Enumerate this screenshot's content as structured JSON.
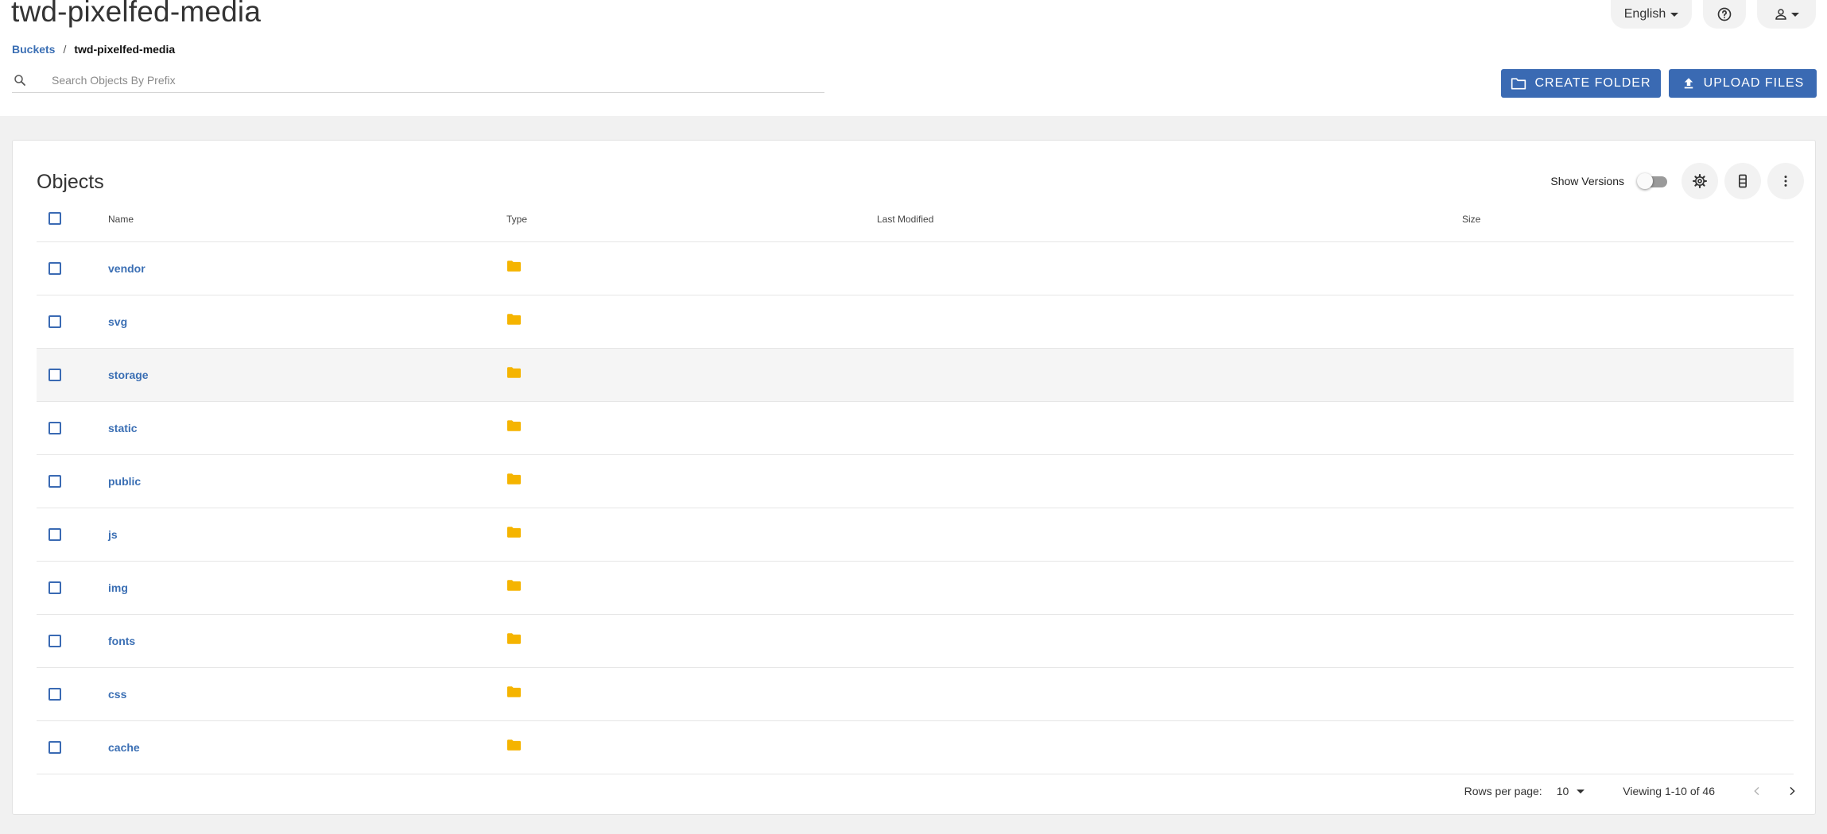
{
  "header": {
    "title": "twd-pixelfed-media",
    "language": "English",
    "breadcrumb": {
      "root": "Buckets",
      "separator": "/",
      "current": "twd-pixelfed-media"
    },
    "search_placeholder": "Search Objects By Prefix",
    "create_folder_label": "CREATE FOLDER",
    "upload_files_label": "UPLOAD FILES"
  },
  "objects": {
    "title": "Objects",
    "show_versions_label": "Show Versions",
    "show_versions_on": false,
    "columns": {
      "name": "Name",
      "type": "Type",
      "last_modified": "Last Modified",
      "size": "Size"
    },
    "rows": [
      {
        "name": "vendor",
        "type": "folder-icon",
        "last_modified": "",
        "size": ""
      },
      {
        "name": "svg",
        "type": "folder-icon",
        "last_modified": "",
        "size": ""
      },
      {
        "name": "storage",
        "type": "folder-icon",
        "last_modified": "",
        "size": ""
      },
      {
        "name": "static",
        "type": "folder-icon",
        "last_modified": "",
        "size": ""
      },
      {
        "name": "public",
        "type": "folder-icon",
        "last_modified": "",
        "size": ""
      },
      {
        "name": "js",
        "type": "folder-icon",
        "last_modified": "",
        "size": ""
      },
      {
        "name": "img",
        "type": "folder-icon",
        "last_modified": "",
        "size": ""
      },
      {
        "name": "fonts",
        "type": "folder-icon",
        "last_modified": "",
        "size": ""
      },
      {
        "name": "css",
        "type": "folder-icon",
        "last_modified": "",
        "size": ""
      },
      {
        "name": "cache",
        "type": "folder-icon",
        "last_modified": "",
        "size": ""
      }
    ]
  },
  "pagination": {
    "rows_per_page_label": "Rows per page:",
    "rows_per_page": "10",
    "viewing": "Viewing 1-10 of 46"
  },
  "colors": {
    "accent": "#3a6ab3",
    "link": "#3b6fb4",
    "folder": "#f5b400",
    "row_highlight": "#f5f5f5"
  }
}
